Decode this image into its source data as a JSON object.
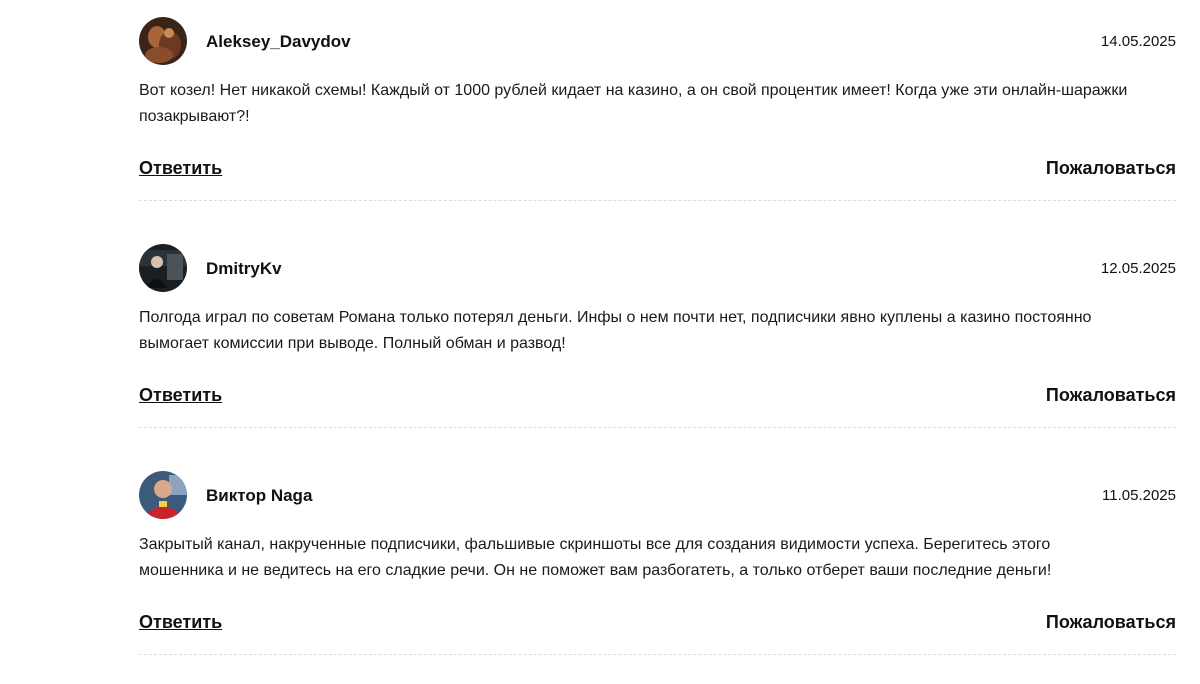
{
  "comments": [
    {
      "author": "Aleksey_Davydov",
      "date": "14.05.2025",
      "text": "Вот козел! Нет никакой схемы! Каждый от 1000 рублей кидает на казино, а он свой процентик имеет! Когда уже эти онлайн-шаражки позакрывают?!",
      "reply_label": "Ответить",
      "report_label": "Пожаловаться",
      "avatar_colors": [
        "#3a2418",
        "#a8653a",
        "#6b3a22"
      ]
    },
    {
      "author": "DmitryKv",
      "date": "12.05.2025",
      "text": "Полгода играл по советам Романа только потерял деньги. Инфы о нем почти нет, подписчики явно куплены а казино постоянно вымогает комиссии при выводе. Полный обман и развод!",
      "reply_label": "Ответить",
      "report_label": "Пожаловаться",
      "avatar_colors": [
        "#1b1f22",
        "#4a5358",
        "#d8c2ae"
      ]
    },
    {
      "author": "Виктор Naga",
      "date": "11.05.2025",
      "text": "Закрытый канал, накрученные подписчики, фальшивые скриншоты все для создания видимости успеха. Берегитесь этого мошенника и не ведитесь на его сладкие речи. Он не поможет вам разбогатеть, а только отберет ваши последние деньги!",
      "reply_label": "Ответить",
      "report_label": "Пожаловаться",
      "avatar_colors": [
        "#c9242a",
        "#3c5a7a",
        "#d9a98a"
      ]
    }
  ]
}
